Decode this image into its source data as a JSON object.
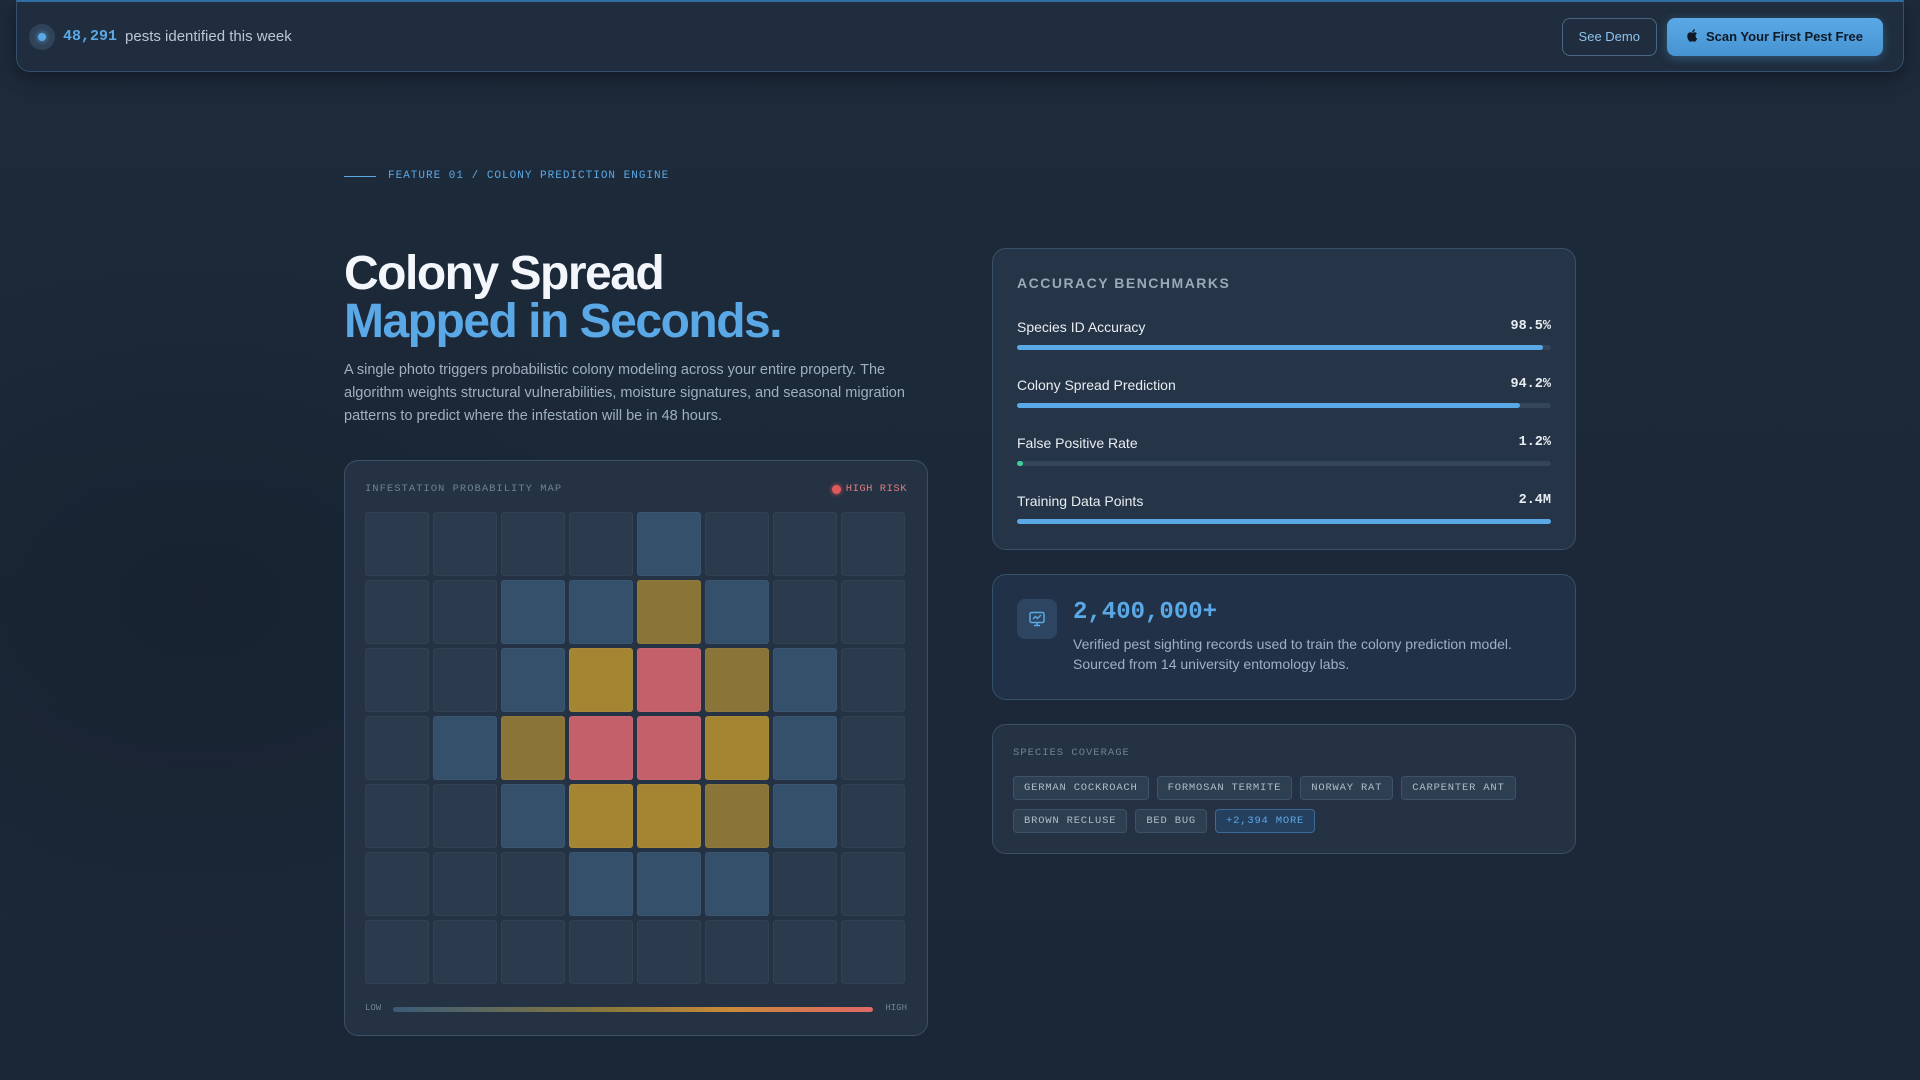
{
  "banner": {
    "count": "48,291",
    "count_label": "pests identified this week",
    "demo_label": "See Demo",
    "cta_label": "Scan Your First Pest Free",
    "cta_icon": "apple-icon"
  },
  "hero": {
    "eyebrow": "FEATURE 01 / COLONY PREDICTION ENGINE",
    "title_line1": "Colony Spread",
    "title_line2": "Mapped in Seconds.",
    "description": "A single photo triggers probabilistic colony modeling across your entire property. The algorithm weights structural vulnerabilities, moisture signatures, and seasonal migration patterns to predict where the infestation will be in 48 hours."
  },
  "map": {
    "title": "INFESTATION PROBABILITY MAP",
    "risk_label": "HIGH RISK",
    "legend_low": "LOW",
    "legend_high": "HIGH",
    "levels": [
      [
        0,
        0,
        0,
        0,
        1,
        0,
        0,
        0
      ],
      [
        0,
        0,
        1,
        1,
        2,
        1,
        0,
        0
      ],
      [
        0,
        0,
        1,
        3,
        4,
        2,
        1,
        0
      ],
      [
        0,
        1,
        2,
        4,
        4,
        3,
        1,
        0
      ],
      [
        0,
        0,
        1,
        3,
        3,
        2,
        1,
        0
      ],
      [
        0,
        0,
        0,
        1,
        1,
        1,
        0,
        0
      ],
      [
        0,
        0,
        0,
        0,
        0,
        0,
        0,
        0
      ]
    ],
    "colors": {
      "level0": "#2b3a4c",
      "level1": "#34506b",
      "level2": "#8a7438",
      "level3": "#a38532",
      "level4": "#c4606a"
    }
  },
  "accuracy": {
    "title": "ACCURACY BENCHMARKS",
    "metrics": [
      {
        "label": "Species ID Accuracy",
        "value": "98.5%",
        "fraction": 0.985,
        "color": "#5aa9e6"
      },
      {
        "label": "Colony Spread Prediction",
        "value": "94.2%",
        "fraction": 0.942,
        "color": "#5aa9e6"
      },
      {
        "label": "False Positive Rate",
        "value": "1.2%",
        "fraction": 0.012,
        "color": "#3ecf9a"
      },
      {
        "label": "Training Data Points",
        "value": "2.4M",
        "fraction": 1.0,
        "color": "#5aa9e6"
      }
    ]
  },
  "records": {
    "icon": "monitor-icon",
    "number": "2,400,000+",
    "description": "Verified pest sighting records used to train the colony prediction model. Sourced from 14 university entomology labs."
  },
  "species": {
    "title": "SPECIES COVERAGE",
    "tags": [
      "GERMAN COCKROACH",
      "FORMOSAN TERMITE",
      "NORWAY RAT",
      "CARPENTER ANT",
      "BROWN RECLUSE",
      "BED BUG"
    ],
    "more": "+2,394 MORE"
  }
}
